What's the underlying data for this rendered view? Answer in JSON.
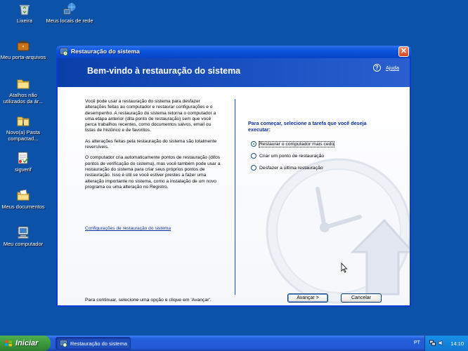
{
  "desktop": {
    "icons": [
      {
        "label": "Lixeira",
        "icon": "recycle-bin-icon"
      },
      {
        "label": "Meus locais de rede",
        "icon": "network-places-icon"
      },
      {
        "label": "Meu porta-arquivos",
        "icon": "briefcase-icon"
      },
      {
        "label": "Atalhos não utilizados da ár...",
        "icon": "folder-icon"
      },
      {
        "label": "Novo(a) Pasta compactad...",
        "icon": "zip-folder-icon"
      },
      {
        "label": "sigverif",
        "icon": "sigverif-icon"
      },
      {
        "label": "Meus documentos",
        "icon": "my-documents-icon"
      },
      {
        "label": "Meu computador",
        "icon": "my-computer-icon"
      }
    ]
  },
  "window": {
    "title": "Restauração do sistema",
    "close_label": "✕",
    "banner_title": "Bem-vindo à restauração do sistema",
    "help_icon": "?",
    "help_label": "Ajuda",
    "intro_paragraphs": [
      "Você pode usar a restauração do sistema para desfazer alterações feitas ao computador e restaurar configurações e o desempenho. A restauração do sistema retorna o computador a uma etapa anterior (dita ponto de restauração) sem que você perca trabalhos recentes, como documentos salvos, email ou listas de histórico e de favoritos.",
      "As alterações feitas pela restauração do sistema são totalmente reversíveis.",
      "O computador cria automaticamente pontos de restauração (ditos pontos de verificação do sistema), mas você também pode usar a restauração do sistema para criar seus próprios pontos de restauração. Isso é útil se você estiver prestes a fazer uma alteração importante no sistema, como a instalação de um novo programa ou uma alteração no Registro."
    ],
    "config_link": "Configurações de restauração do sistema",
    "footer_text": "Para continuar, selecione uma opção e clique em 'Avançar'.",
    "prompt": "Para começar, selecione a tarefa que você deseja executar:",
    "options": [
      {
        "label": "Restaurar o computador mais cedo",
        "selected": true
      },
      {
        "label": "Criar um ponto de restauração",
        "selected": false
      },
      {
        "label": "Desfazer a última restauração",
        "selected": false
      }
    ],
    "next_label": "Avançar >",
    "cancel_label": "Cancelar"
  },
  "taskbar": {
    "start_label": "Iniciar",
    "task_item_label": "Restauração do sistema",
    "language": "PT",
    "clock": "14:10"
  },
  "colors": {
    "desktop": "#0b52a8",
    "title_bar": "#0a55de",
    "start_button": "#3c9b3c",
    "link": "#0b33a5"
  }
}
